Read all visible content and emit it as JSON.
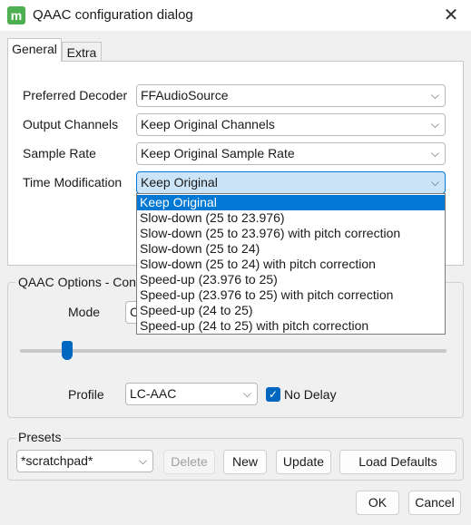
{
  "window": {
    "title": "QAAC configuration dialog",
    "close_glyph": "✕",
    "icon_glyph": "m"
  },
  "tabs": [
    {
      "label": "General"
    },
    {
      "label": "Extra"
    }
  ],
  "general": {
    "preferred_decoder": {
      "label": "Preferred Decoder",
      "value": "FFAudioSource"
    },
    "output_channels": {
      "label": "Output Channels",
      "value": "Keep Original Channels"
    },
    "sample_rate": {
      "label": "Sample Rate",
      "value": "Keep Original Sample Rate"
    },
    "time_modification": {
      "label": "Time Modification",
      "value": "Keep Original",
      "options": [
        "Keep Original",
        "Slow-down (25 to 23.976)",
        "Slow-down (25 to 23.976) with pitch correction",
        "Slow-down (25 to 24)",
        "Slow-down (25 to 24) with pitch correction",
        "Speed-up (23.976 to 25)",
        "Speed-up (23.976 to 25) with pitch correction",
        "Speed-up (24 to 25)",
        "Speed-up (24 to 25) with pitch correction"
      ]
    }
  },
  "qaac_options": {
    "group_title": "QAAC Options - Cons",
    "mode_label": "Mode",
    "mode_value": "C",
    "profile_label": "Profile",
    "profile_value": "LC-AAC",
    "no_delay_label": "No Delay",
    "no_delay_checked": true
  },
  "presets": {
    "group_title": "Presets",
    "current": "*scratchpad*",
    "delete_label": "Delete",
    "new_label": "New",
    "update_label": "Update",
    "load_defaults_label": "Load Defaults"
  },
  "footer": {
    "ok_label": "OK",
    "cancel_label": "Cancel"
  },
  "icons": {
    "chevron": "⌵",
    "check": "✓"
  },
  "colors": {
    "accent": "#0078d4",
    "selection_bg": "#cce4f7"
  }
}
